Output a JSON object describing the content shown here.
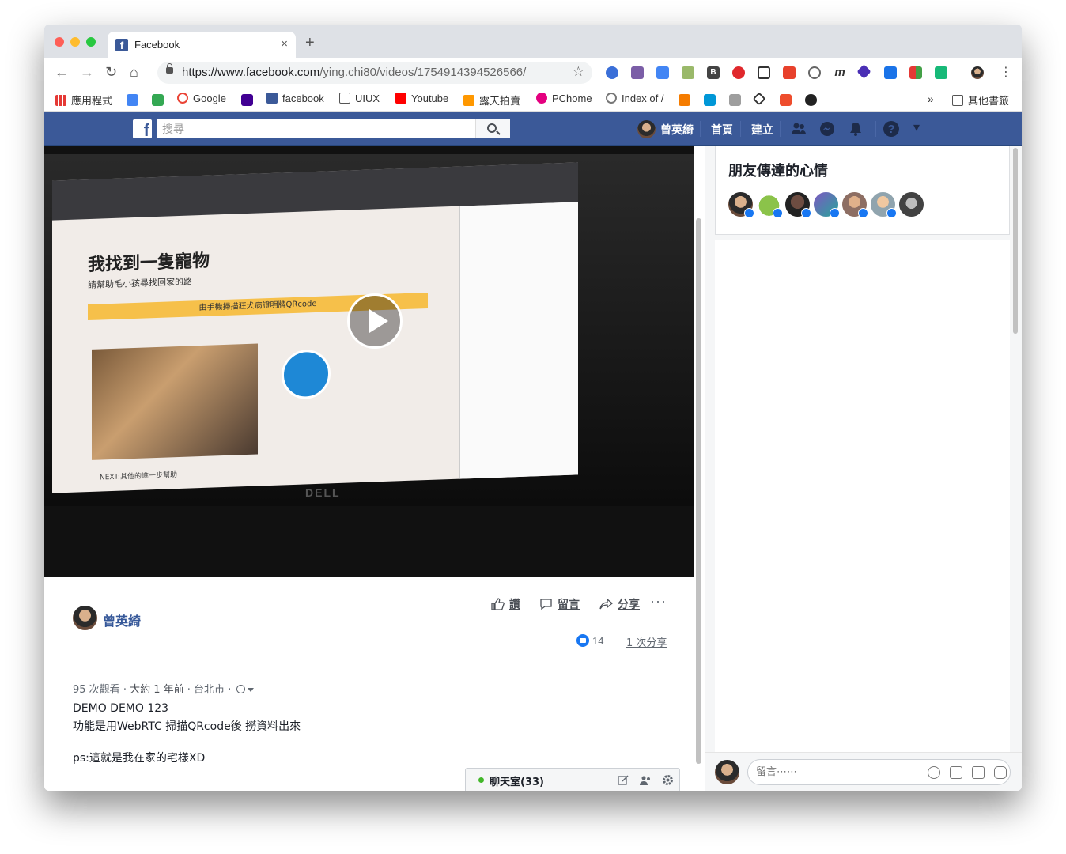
{
  "browser": {
    "tab_title": "Facebook",
    "tab_close": "×",
    "new_tab": "+",
    "url_host": "https://www.facebook.com",
    "url_path": "/ying.chi80/videos/1754914394526566/",
    "star": "☆",
    "menu": "⋮",
    "nav": {
      "back": "←",
      "forward": "→",
      "reload": "↻",
      "home": "⌂"
    }
  },
  "bookmarks": {
    "apps": "應用程式",
    "items": [
      "Google",
      "facebook",
      "UIUX",
      "Youtube",
      "露天拍賣",
      "PChome",
      "Index of /"
    ],
    "overflow": "»",
    "other": "其他書籤"
  },
  "facebook": {
    "logo": "f",
    "search_placeholder": "搜尋",
    "user_name": "曾英綺",
    "nav_home": "首頁",
    "nav_create": "建立",
    "help": "?",
    "dropdown": "▾"
  },
  "video_screen": {
    "title": "我找到一隻寵物",
    "subtitle": "請幫助毛小孩尋找回家的路",
    "bar": "由手機掃描狂犬病證明牌QRcode",
    "next": "NEXT:其他的進一步幫助",
    "brand": "DELL"
  },
  "post": {
    "author": "曾英綺",
    "actions": {
      "like": "讚",
      "comment": "留言",
      "share": "分享"
    },
    "more": "···",
    "like_count": "14",
    "share_count": "1 次分享",
    "views": "95 次觀看",
    "time": "大約 1 年前",
    "location": "台北市",
    "separator": " · ",
    "description": [
      "DEMO DEMO 123",
      "功能是用WebRTC 掃描QRcode後 撈資料出來",
      "ps:這就是我在家的宅樣XD"
    ]
  },
  "sidebar": {
    "title": "朋友傳達的心情",
    "comment_placeholder": "留言⋯⋯"
  },
  "chat": {
    "label": "聊天室(33)"
  }
}
